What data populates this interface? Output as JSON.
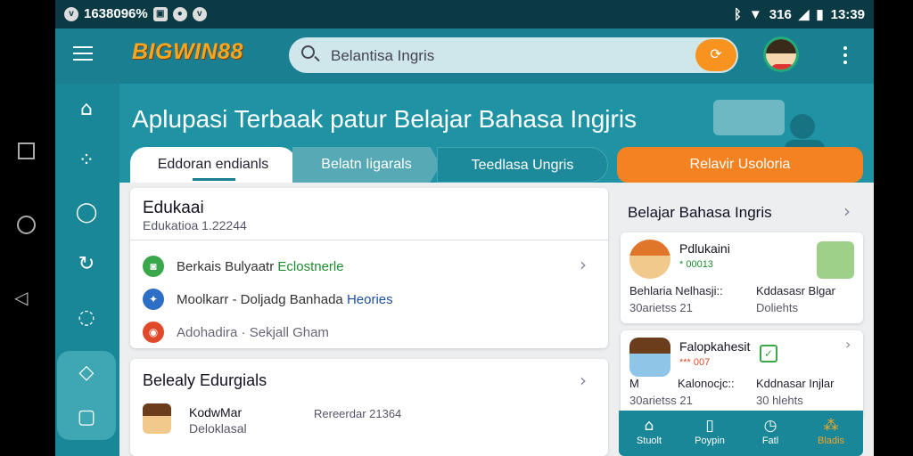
{
  "status": {
    "left_text": "1638096%",
    "network": "316",
    "time": "13:39"
  },
  "topbar": {
    "logo": "BIGWIN88",
    "search_text": "Belantisa Ingris"
  },
  "hero": {
    "title": "Aplupasi Terbaak patur Belajar Bahasa Ingjris"
  },
  "tabs": [
    {
      "label": "Eddoran endianls"
    },
    {
      "label": "Belatn Iigarals"
    },
    {
      "label": "Teedlasa Ungris"
    },
    {
      "label": "Relavir Usoloria"
    }
  ],
  "card1": {
    "title": "Edukaai",
    "subtitle": "Edukatioa 1.22244",
    "rows": [
      {
        "text": "Berkais Bulyaatr ",
        "highlight": "Eclostnerle"
      },
      {
        "text": "Moolkarr - Doljadg Banhada ",
        "highlight": "Heories"
      },
      {
        "text": "Adohadira · Sekjall Gham",
        "highlight": ""
      }
    ]
  },
  "card2": {
    "title": "Belealy Edurgials",
    "item_name": "KodwMar",
    "item_sub": "Deloklasal",
    "item_date": "Rereerdar 21364"
  },
  "right_panel": {
    "title": "Belajar Bahasa Ingris",
    "cards": [
      {
        "name": "Pdlukaini",
        "meta": "* 00013",
        "left1": "Behlaria Nelhasji::",
        "left2": "30arietss 21",
        "right1": "Kddasasr Blgar",
        "right2": "Doliehts"
      },
      {
        "name": "Falopkahesit",
        "meta": "*** 007",
        "left1": "M",
        "left2": "30arietss 21",
        "right1": "Kddnasar Injlar",
        "right2": "30 hlehts",
        "center1": "Kalonocjc::"
      }
    ]
  },
  "bottom_nav": [
    {
      "label": "Stuolt",
      "icon": "home-icon"
    },
    {
      "label": "Poypin",
      "icon": "book-icon"
    },
    {
      "label": "Fatl",
      "icon": "clock-icon"
    },
    {
      "label": "Bladis",
      "icon": "people-icon"
    }
  ],
  "colors": {
    "teal": "#1f93a4",
    "orange": "#f58220",
    "logo": "#f5a623"
  }
}
